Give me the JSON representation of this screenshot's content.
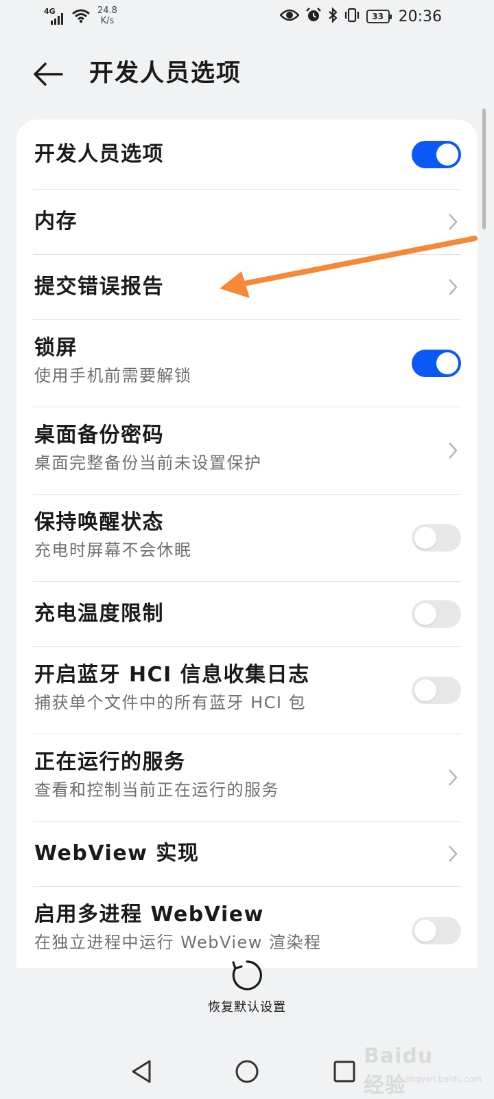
{
  "status_bar": {
    "network": "4G",
    "speed_value": "24.8",
    "speed_unit": "K/s",
    "battery": "33",
    "time": "20:36",
    "icons": [
      "signal-icon",
      "wifi-icon",
      "eye-icon",
      "alarm-icon",
      "bluetooth-icon",
      "vibrate-icon",
      "battery-icon"
    ]
  },
  "header": {
    "title": "开发人员选项",
    "back_icon": "back-arrow-icon"
  },
  "settings": [
    {
      "title": "开发人员选项",
      "subtitle": "",
      "control": "toggle",
      "state": "on"
    },
    {
      "title": "内存",
      "subtitle": "",
      "control": "chevron"
    },
    {
      "title": "提交错误报告",
      "subtitle": "",
      "control": "chevron"
    },
    {
      "title": "锁屏",
      "subtitle": "使用手机前需要解锁",
      "control": "toggle",
      "state": "on"
    },
    {
      "title": "桌面备份密码",
      "subtitle": "桌面完整备份当前未设置保护",
      "control": "chevron"
    },
    {
      "title": "保持唤醒状态",
      "subtitle": "充电时屏幕不会休眠",
      "control": "toggle",
      "state": "off"
    },
    {
      "title": "充电温度限制",
      "subtitle": "",
      "control": "toggle",
      "state": "off"
    },
    {
      "title": "开启蓝牙 HCI 信息收集日志",
      "subtitle": "捕获单个文件中的所有蓝牙 HCI 包",
      "control": "toggle",
      "state": "off"
    },
    {
      "title": "正在运行的服务",
      "subtitle": "查看和控制当前正在运行的服务",
      "control": "chevron"
    },
    {
      "title": "WebView 实现",
      "subtitle": "",
      "control": "chevron"
    },
    {
      "title": "启用多进程 WebView",
      "subtitle": "在独立进程中运行 WebView 渲染程",
      "control": "toggle",
      "state": "off"
    }
  ],
  "footer": {
    "restore_label": "恢复默认设置",
    "restore_icon": "reset-icon"
  },
  "nav_bar": {
    "icons": [
      "nav-back-icon",
      "nav-home-icon",
      "nav-recents-icon"
    ]
  },
  "watermark": {
    "logo": "Baidu经验",
    "url": "jingyan.baidu.com"
  },
  "colors": {
    "accent": "#0a59f7",
    "background": "#f1f2f4",
    "annotation_arrow": "#f5893a"
  }
}
